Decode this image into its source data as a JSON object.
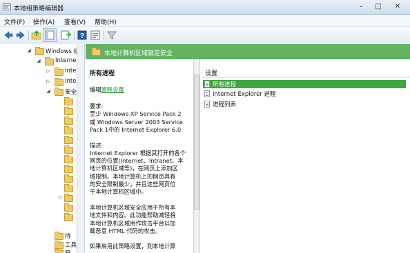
{
  "window": {
    "title": "本地组策略编辑器",
    "controls": {
      "minimize": "–",
      "maximize": "□",
      "close": "✕"
    }
  },
  "menu": [
    {
      "label": "文件(F)"
    },
    {
      "label": "操作(A)"
    },
    {
      "label": "查看(V)"
    },
    {
      "label": "帮助(H)"
    }
  ],
  "toolbar": {
    "icons": [
      "back-icon",
      "forward-icon",
      "up-folder-icon",
      "show-hide-tree-icon",
      "export-list-icon",
      "help-icon",
      "properties-icon",
      "filter-icon"
    ]
  },
  "tree": {
    "items": [
      {
        "label": "Windows 组"
      },
      {
        "label": "Interne"
      },
      {
        "label": "Inte"
      },
      {
        "label": "Inte"
      },
      {
        "label": "安全"
      },
      {
        "label": "持"
      },
      {
        "label": "工具"
      },
      {
        "label": "管"
      }
    ]
  },
  "header": {
    "title": "本地计算机区域锁定安全"
  },
  "description": {
    "heading": "所有进程",
    "edit_prefix": "编辑",
    "edit_link": "策略设置",
    "lines": [
      "要求:",
      "至少 Windows XP Service Pack 2",
      "或 Windows Server 2003 Service",
      "Pack 1中的 Internet Explorer 6.0",
      "",
      "描述:",
      "Internet Explorer 根据其打开的各个",
      "网页的位置(Internet、Intranet、本",
      "地计算机区域等)，在网页上添加区",
      "域限制。本地计算机上的网页具有",
      "的安全限制最少，并且这些网页位",
      "于本地计算机区域中。",
      "",
      "本地计算机区域安全应用于所有本",
      "地文件和内容。此功能帮助减轻将",
      "本地计算机区域用作攻击平台以加",
      "载恶意 HTML 代码的攻击。",
      "",
      "如果启用此策略设置，则本地计算"
    ]
  },
  "settings": {
    "header": "设置",
    "items": [
      {
        "label": "所有进程",
        "selected": true
      },
      {
        "label": "Internet Explorer 进程",
        "selected": false
      },
      {
        "label": "进程列表",
        "selected": false
      }
    ]
  },
  "colors": {
    "accent_green": "#62b462",
    "selection_green": "#3ea73e",
    "link_green": "#2a9a2a"
  }
}
